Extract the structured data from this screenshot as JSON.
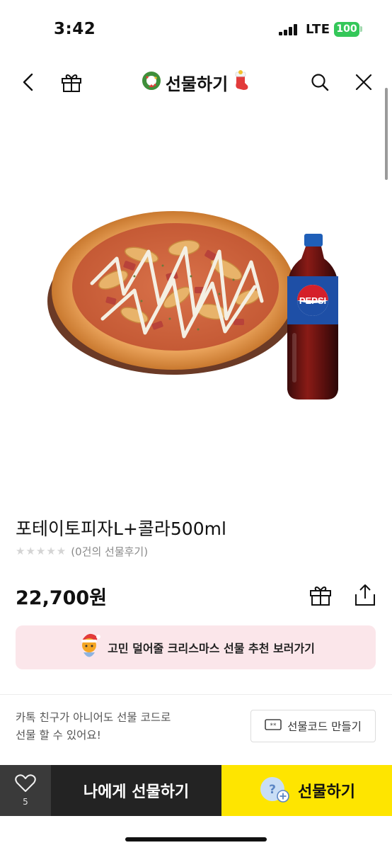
{
  "status_bar": {
    "time": "3:42",
    "network": "LTE",
    "battery": "100",
    "battery_color": "#34c759"
  },
  "nav": {
    "title": "선물하기",
    "icons": [
      "back-icon",
      "gift-box-icon",
      "wreath-icon",
      "gift-sock-icon",
      "search-icon",
      "close-icon"
    ]
  },
  "product": {
    "name": "포테이토피자L+콜라500ml",
    "rating_stars": 0,
    "review_text": "(0건의 선물후기)",
    "price": "22,700원",
    "image_label": "PEPSI"
  },
  "banner": {
    "text": "고민 덜어줄 크리스마스 선물 추천 보러가기",
    "background": "#fbe6ea"
  },
  "gift_code": {
    "info": "카톡 친구가 아니어도 선물 코드로\n선물 할 수 있어요!",
    "button_label": "선물코드 만들기"
  },
  "bottom_bar": {
    "like_count": "5",
    "gift_self_label": "나에게 선물하기",
    "gift_label": "선물하기",
    "accent": "#fee500"
  }
}
